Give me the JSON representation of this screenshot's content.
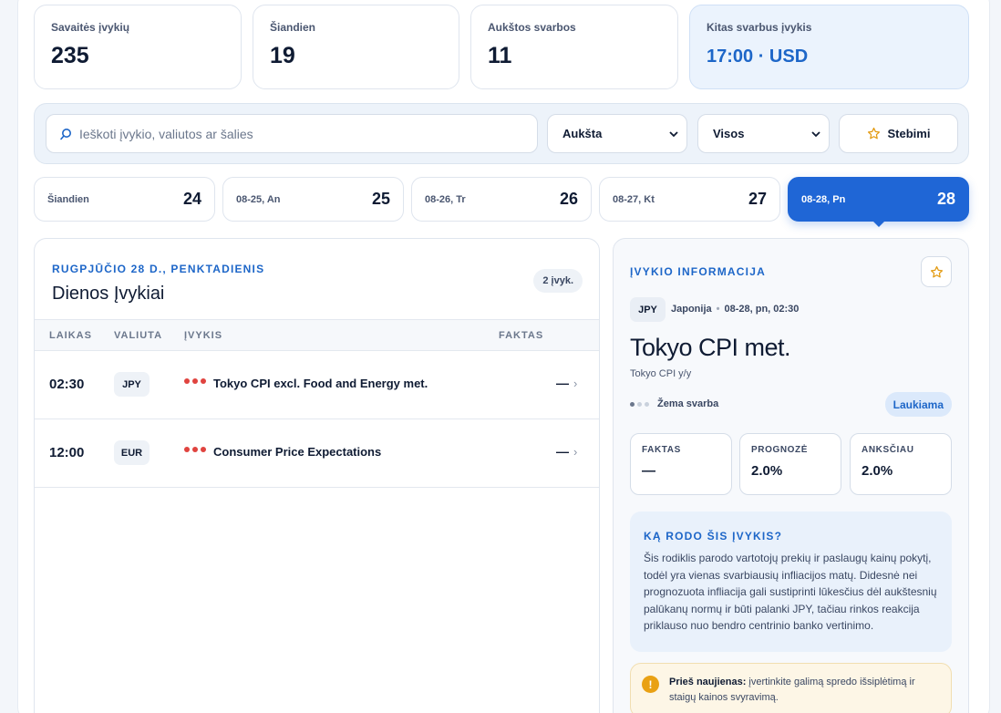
{
  "stats": [
    {
      "label": "Savaitės įvykių",
      "value": "235"
    },
    {
      "label": "Šiandien",
      "value": "19"
    },
    {
      "label": "Aukštos svarbos",
      "value": "11"
    },
    {
      "label": "Kitas svarbus įvykis",
      "value": "17:00 · USD"
    }
  ],
  "filters": {
    "search_placeholder": "Ieškoti įvykio, valiutos ar šalies",
    "importance_selected": "Aukšta",
    "currency_selected": "Visos",
    "watch_label": "Stebimi",
    "accent_color": "#1f66d6"
  },
  "days": [
    {
      "label": "Šiandien",
      "num": "24"
    },
    {
      "label": "08-25, An",
      "num": "25"
    },
    {
      "label": "08-26, Tr",
      "num": "26"
    },
    {
      "label": "08-27, Kt",
      "num": "27"
    },
    {
      "label": "08-28, Pn",
      "num": "28",
      "active": true
    }
  ],
  "list": {
    "date_heading": "RUGPJŪČIO 28 D., PENKTADIENIS",
    "title": "Dienos Įvykiai",
    "count": "2 įvyk.",
    "columns": [
      "LAIKAS",
      "VALIUTA",
      "ĮVYKIS",
      "FAKTAS"
    ],
    "rows": [
      {
        "time": "02:30",
        "currency": "JPY",
        "event": "Tokyo CPI excl. Food and Energy met.",
        "fact": "—"
      },
      {
        "time": "12:00",
        "currency": "EUR",
        "event": "Consumer Price Expectations",
        "fact": "—"
      }
    ]
  },
  "detail": {
    "heading": "ĮVYKIO INFORMACIJA",
    "currency": "JPY",
    "country": "Japonija",
    "datetime": "08-28, pn, 02:30",
    "title": "Tokyo CPI met.",
    "subtitle": "Tokyo CPI y/y",
    "importance": "Žema svarba",
    "status": "Laukiama",
    "metrics": [
      {
        "label": "FAKTAS",
        "value": "—"
      },
      {
        "label": "PROGNOZĖ",
        "value": "2.0%"
      },
      {
        "label": "ANKSČIAU",
        "value": "2.0%"
      }
    ],
    "info_heading": "KĄ RODO ŠIS ĮVYKIS?",
    "info_text": "Šis rodiklis parodo vartotojų prekių ir paslaugų kainų pokytį, todėl yra vienas svarbiausių infliacijos matų. Didesnė nei prognozuota infliacija gali sustiprinti lūkesčius dėl aukštesnių palūkanų normų ir būti palanki JPY, tačiau rinkos reakcija priklauso nuo bendro centrinio banko vertinimo.",
    "warning_bold": "Prieš naujienas:",
    "warning_text": " įvertinkite galimą spredo išsiplėtimą ir staigų kainos svyravimą."
  }
}
